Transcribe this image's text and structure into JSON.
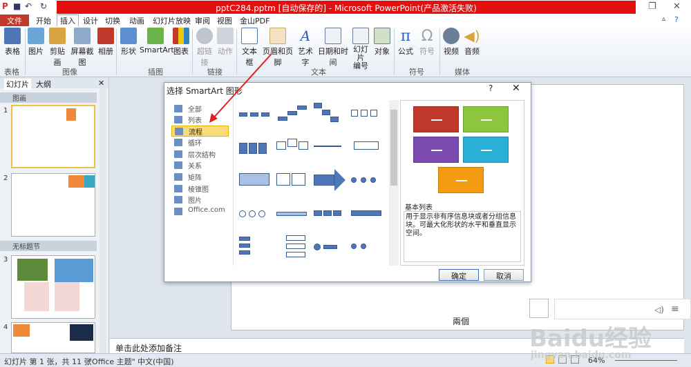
{
  "window": {
    "title": "pptC284.pptm [自动保存的] - Microsoft PowerPoint(产品激活失败)"
  },
  "tabs": {
    "file": "文件",
    "items": [
      "开始",
      "插入",
      "设计",
      "切换",
      "动画",
      "幻灯片放映",
      "审阅",
      "视图",
      "金山PDF"
    ]
  },
  "ribbon": {
    "buttons": [
      "表格",
      "图片",
      "剪贴画",
      "屏幕截图",
      "相册",
      "形状",
      "SmartArt",
      "图表",
      "超链接",
      "动作",
      "文本框",
      "页眉和页脚",
      "艺术字",
      "日期和时间",
      "幻灯片\n编号",
      "对象",
      "公式",
      "符号",
      "视频",
      "音频"
    ],
    "groups": [
      "表格",
      "图像",
      "插图",
      "链接",
      "文本",
      "符号",
      "媒体"
    ]
  },
  "panel": {
    "tabs": [
      "幻灯片",
      "大纲"
    ],
    "sections": [
      "图画",
      "无标题节"
    ],
    "slides": [
      "1",
      "2",
      "3",
      "4"
    ]
  },
  "notes": {
    "placeholder": "单击此处添加备注"
  },
  "slide": {
    "caption": "兩個"
  },
  "status": {
    "slide_info": "幻灯片 第 1 张，共 11 张",
    "theme": "\"Office 主题\"",
    "lang": "中文(中国)",
    "zoom": "64%"
  },
  "dialog": {
    "title": "选择 SmartArt 图形",
    "help": "?",
    "categories": [
      "全部",
      "列表",
      "流程",
      "循环",
      "层次结构",
      "关系",
      "矩阵",
      "棱锥图",
      "图片",
      "Office.com"
    ],
    "selected_category": "流程",
    "preview_name": "基本列表",
    "preview_desc": "用于显示非有序信息块或者分组信息块。可最大化形状的水平和垂直显示空间。",
    "ok": "确定",
    "cancel": "取消",
    "colors": {
      "red": "#c0392b",
      "green": "#8cc63f",
      "purple": "#7b4bb0",
      "cyan": "#2ab0d8",
      "orange": "#f39c12"
    }
  },
  "watermark": {
    "brand": "Baidu经验",
    "url": "jingyan.baidu.com"
  }
}
